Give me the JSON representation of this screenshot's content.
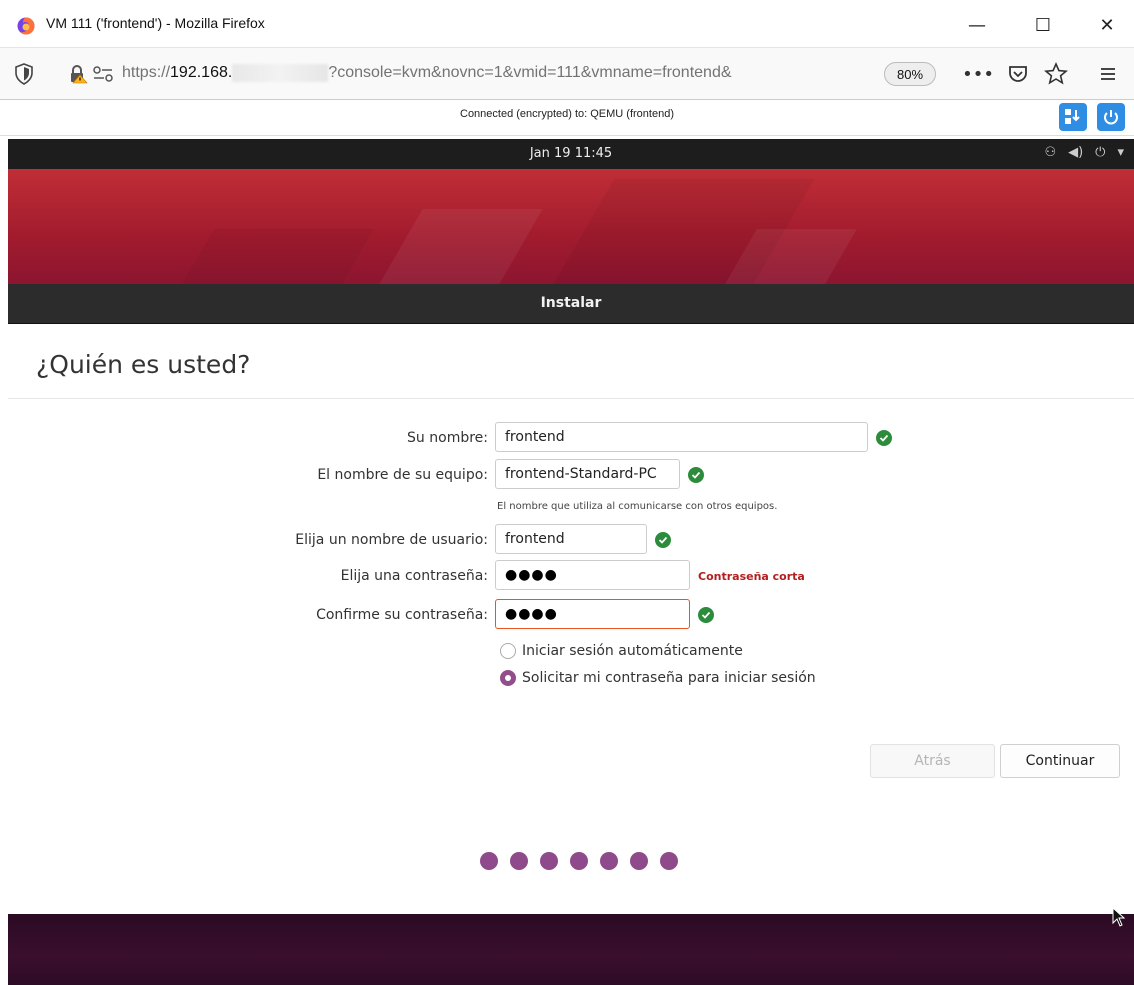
{
  "browser": {
    "window_title": "VM 111 ('frontend') - Mozilla Firefox",
    "url_prefix": "https://",
    "url_host": "192.168.",
    "url_rest": "?console=kvm&novnc=1&vmid=111&vmname=frontend&",
    "zoom": "80%",
    "window_buttons": [
      "—",
      "☐",
      "✕"
    ]
  },
  "vnc": {
    "status_message": "Connected (encrypted) to: QEMU (frontend)"
  },
  "ubuntu": {
    "clock": "Jan 19  11:45",
    "tray": [
      "⚇",
      "◀)",
      "⏻",
      "▾"
    ]
  },
  "installer": {
    "header": "Instalar",
    "title": "¿Quién es usted?",
    "name_label": "Su nombre:",
    "name_value": "frontend",
    "computer_label": "El nombre de su equipo:",
    "computer_value": "frontend-Standard-PC",
    "computer_hint": "El nombre que utiliza al comunicarse con otros equipos.",
    "username_label": "Elija un nombre de usuario:",
    "username_value": "frontend",
    "password_label": "Elija una contraseña:",
    "password_value": "●●●●",
    "password_warning": "Contraseña corta",
    "confirm_label": "Confirme su contraseña:",
    "confirm_value": "●●●●",
    "radio_auto_login": "Iniciar sesión automáticamente",
    "radio_require_password": "Solicitar mi contraseña para iniciar sesión",
    "back_button": "Atrás",
    "continue_button": "Continuar",
    "progress_steps": 7
  },
  "colors": {
    "accent_purple": "#924d8b",
    "check_green": "#2c8c3c",
    "warning_red": "#b31e1e",
    "focus_orange": "#e95420",
    "vnc_blue": "#2f8de4"
  }
}
